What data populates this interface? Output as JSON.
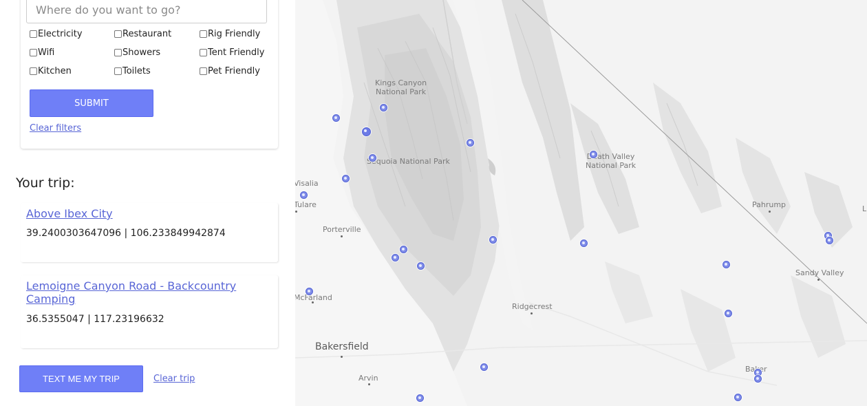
{
  "search": {
    "placeholder": "Where do you want to go?"
  },
  "filters": {
    "amenities": [
      {
        "label": "Electricity",
        "checked": false
      },
      {
        "label": "Restaurant",
        "checked": false
      },
      {
        "label": "Rig Friendly",
        "checked": false
      },
      {
        "label": "Wifi",
        "checked": false
      },
      {
        "label": "Showers",
        "checked": false
      },
      {
        "label": "Tent Friendly",
        "checked": false
      },
      {
        "label": "Kitchen",
        "checked": false
      },
      {
        "label": "Toilets",
        "checked": false
      },
      {
        "label": "Pet Friendly",
        "checked": false
      }
    ],
    "submit_label": "SUBMIT",
    "clear_label": "Clear filters"
  },
  "trip": {
    "heading": "Your trip:",
    "items": [
      {
        "name": "Above Ibex City",
        "coords": "39.2400303647096 | 106.233849942874"
      },
      {
        "name": "Lemoigne Canyon Road - Backcountry Camping",
        "coords": "36.5355047 | 117.23196632"
      }
    ],
    "text_button_label": "TEXT ME MY TRIP",
    "clear_label": "Clear trip"
  },
  "map": {
    "places": [
      {
        "name": "Kings Canyon\nNational Park"
      },
      {
        "name": "Sequoia National Park"
      },
      {
        "name": "Death Valley\nNational Park"
      },
      {
        "name": "Visalia"
      },
      {
        "name": "Tulare"
      },
      {
        "name": "Porterville"
      },
      {
        "name": "Pahrump"
      },
      {
        "name": "Sandy Valley"
      },
      {
        "name": "McFarland"
      },
      {
        "name": "Ridgecrest"
      },
      {
        "name": "Bakersfield"
      },
      {
        "name": "Arvin"
      },
      {
        "name": "Baker"
      },
      {
        "name": "L"
      }
    ],
    "colors": {
      "marker": "#7f8ce8",
      "accent": "#6f7ff7",
      "link": "#5865d6"
    }
  }
}
